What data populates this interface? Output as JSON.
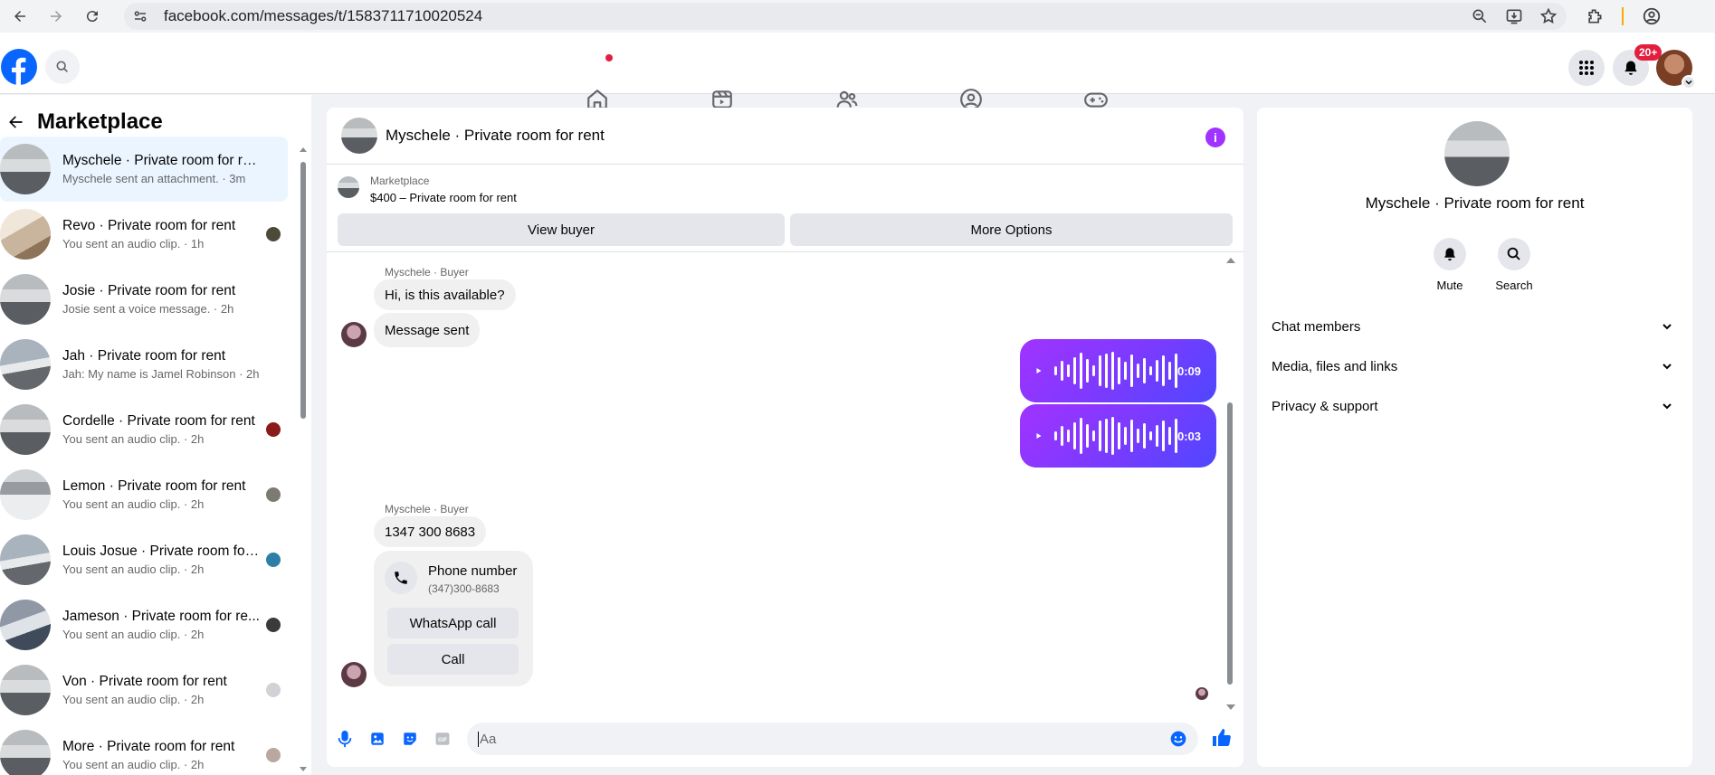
{
  "browser": {
    "url": "facebook.com/messages/t/1583711710020524"
  },
  "header": {
    "notification_badge": "20+"
  },
  "sidebar": {
    "title": "Marketplace",
    "conversations": [
      {
        "name": "Myschele · Private room for rent",
        "sub": "Myschele sent an attachment. · 3m",
        "active": true
      },
      {
        "name": "Revo · Private room for rent",
        "sub": "You sent an audio clip. · 1h"
      },
      {
        "name": "Josie · Private room for rent",
        "sub": "Josie sent a voice message. · 2h"
      },
      {
        "name": "Jah · Private room for rent",
        "sub": "Jah: My name is Jamel Robinson · 2h"
      },
      {
        "name": "Cordelle · Private room for rent",
        "sub": "You sent an audio clip. · 2h"
      },
      {
        "name": "Lemon · Private room for rent",
        "sub": "You sent an audio clip. · 2h"
      },
      {
        "name": "Louis Josue · Private room for...",
        "sub": "You sent an audio clip. · 2h"
      },
      {
        "name": "Jameson · Private room for re...",
        "sub": "You sent an audio clip. · 2h"
      },
      {
        "name": "Von · Private room for rent",
        "sub": "You sent an audio clip. · 2h"
      },
      {
        "name": "More · Private room for rent",
        "sub": "You sent an audio clip. · 2h"
      }
    ]
  },
  "chat": {
    "title": "Myschele · Private room for rent",
    "marketplace_label": "Marketplace",
    "listing": "$400 – Private room for rent",
    "view_buyer": "View buyer",
    "more_options": "More Options",
    "messages": {
      "sender1": "Myschele · Buyer",
      "msg1": "Hi, is this available?",
      "msg2": "Message sent",
      "voice1_duration": "0:09",
      "voice2_duration": "0:03",
      "sender2": "Myschele · Buyer",
      "msg3": "1347 300 8683",
      "phone_card_title": "Phone number",
      "phone_card_number": "(347)300-8683",
      "whatsapp_call": "WhatsApp call",
      "call": "Call"
    },
    "composer_placeholder": "Aa"
  },
  "right_panel": {
    "name": "Myschele · Private room for rent",
    "mute_label": "Mute",
    "search_label": "Search",
    "sections": [
      "Chat members",
      "Media, files and links",
      "Privacy & support"
    ]
  },
  "colors": {
    "brand": "#0866ff",
    "voice_gradient": "#a033ff",
    "active_conv": "#ebf5ff"
  }
}
